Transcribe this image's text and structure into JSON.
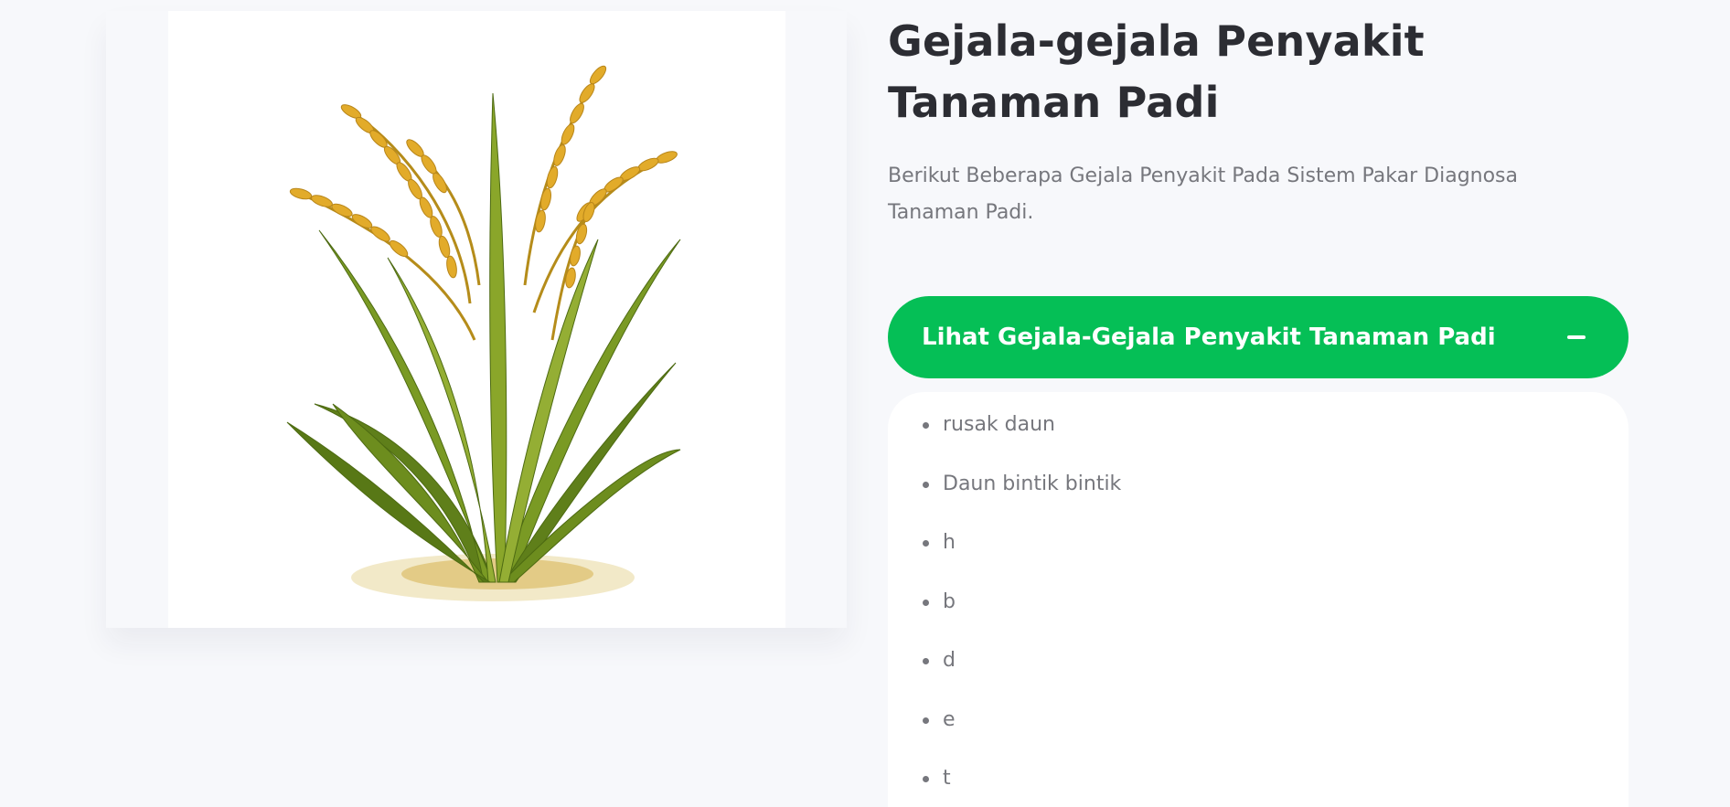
{
  "hero": {
    "image_alt": "rice plant illustration"
  },
  "content": {
    "title": "Gejala-gejala Penyakit Tanaman Padi",
    "subtitle": "Berikut Beberapa Gejala Penyakit Pada Sistem Pakar Diagnosa Tanaman Padi."
  },
  "accordion": {
    "header_label": "Lihat Gejala-Gejala Penyakit Tanaman Padi",
    "toggle_icon": "minus-icon",
    "items": [
      {
        "label": "rusak daun"
      },
      {
        "label": "Daun bintik bintik"
      },
      {
        "label": "h"
      },
      {
        "label": "b"
      },
      {
        "label": "d"
      },
      {
        "label": "e"
      },
      {
        "label": "t"
      }
    ]
  },
  "colors": {
    "page_background": "#f7f8fb",
    "accent_green": "#05bf56",
    "heading": "#2c2d33",
    "muted_text": "#76777d"
  }
}
